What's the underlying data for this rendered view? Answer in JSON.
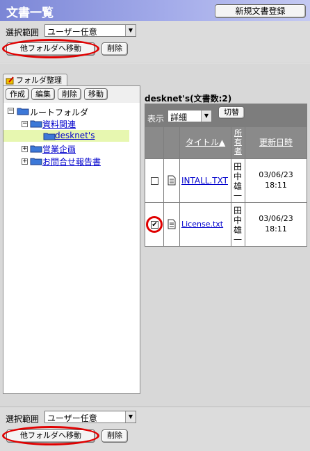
{
  "window": {
    "title": "文書一覧",
    "new_doc_button": "新規文書登録"
  },
  "top_bar": {
    "scope_label": "選択範囲",
    "scope_value": "ユーザー任意",
    "move_button": "他フォルダへ移動",
    "delete_button": "削除"
  },
  "tree": {
    "tab_label": "フォルダ整理",
    "toolbar": {
      "create": "作成",
      "edit": "編集",
      "delete": "削除",
      "move": "移動"
    },
    "root": "ルートフォルダ",
    "folders": [
      {
        "label": "資料関連",
        "expander": "−"
      },
      {
        "label": "desknet's",
        "selected": true
      },
      {
        "label": "営業企画",
        "expander": "+"
      },
      {
        "label": "お問合せ報告書",
        "expander": "+"
      }
    ],
    "root_expander": "−"
  },
  "docs": {
    "header": "desknet's(文書数:2)",
    "view_label": "表示",
    "view_value": "詳細",
    "switch_button": "切替",
    "columns": {
      "title": "タイトル▲",
      "owner": "所有者",
      "updated": "更新日時"
    },
    "rows": [
      {
        "checked": false,
        "title": "INTALL.TXT",
        "owner": "田中雄一",
        "date": "03/06/23",
        "time": "18:11"
      },
      {
        "checked": true,
        "title": "License.txt",
        "owner": "田中雄一",
        "date": "03/06/23",
        "time": "18:11"
      }
    ]
  },
  "bottom_bar": {
    "scope_label": "選択範囲",
    "scope_value": "ユーザー任意",
    "move_button": "他フォルダへ移動",
    "delete_button": "削除"
  },
  "colors": {
    "title_bar": "#7b86d6",
    "highlight_oval": "#e00000",
    "selected_folder": "#e7f7b0"
  },
  "icons": [
    "folder-edit-icon",
    "folder-icon",
    "document-icon",
    "dropdown-arrow-icon",
    "checkbox-icon"
  ]
}
